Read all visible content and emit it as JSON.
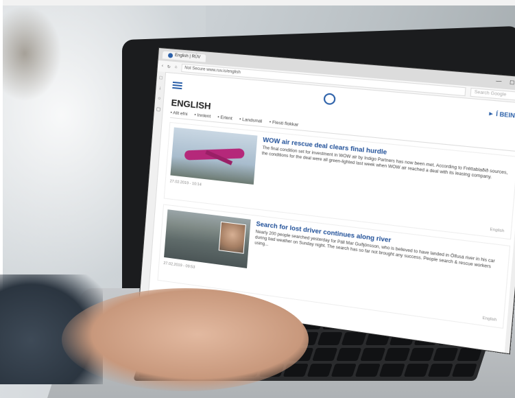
{
  "browser": {
    "tab_title": "English | RÚV",
    "address": "Not Secure   www.ruv.is/english",
    "search_placeholder": "Search Google",
    "window_controls": [
      "—",
      "☐",
      "✕"
    ]
  },
  "site": {
    "section_title": "ENGLISH",
    "lang_link": "► Í BEINNI",
    "nav_items": [
      "• Allt efni",
      "• Innlent",
      "• Erlent",
      "• Landsmál",
      "• Flesti flokkar"
    ]
  },
  "articles": [
    {
      "title": "WOW air rescue deal clears final hurdle",
      "text": "The final condition set for investment in WOW air by Indigo Partners has now been met. According to Fréttablaðið sources, the conditions for the deal were all green-lighted last week when WOW air reached a deal with its leasing company.",
      "date": "27.02.2019 - 10:14",
      "tag": "English"
    },
    {
      "title": "Search for lost driver continues along river",
      "text": "Nearly 200 people searched yesterday for Páll Mar Guðjónsson, who is believed to have landed in Ölfusá river in his car during bad weather on Sunday night. The search has so far not brought any success. People search & rescue workers using...",
      "date": "27.02.2019 - 09:53",
      "tag": "English"
    }
  ]
}
